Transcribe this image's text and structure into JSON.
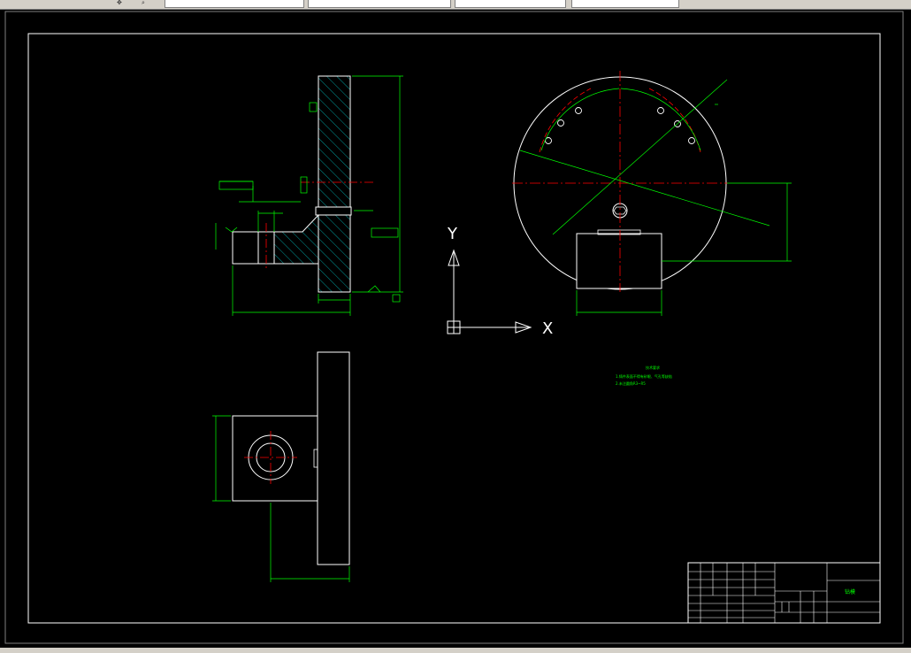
{
  "app": {
    "toolbar_icons": [
      "pan-icon",
      "zoom-icon"
    ]
  },
  "colors": {
    "background": "#000000",
    "outline": "#ffffff",
    "dimension": "#00ff00",
    "centerline": "#ff0000",
    "hatch": "#00ffff"
  },
  "ucs": {
    "y_label": "Y",
    "x_label": "X"
  },
  "notes": {
    "title": "技术要求",
    "line1": "1.铸件表面不得有砂眼、气孔等缺陷",
    "line2": "2.未注圆角R3~R5"
  },
  "title_block": {
    "part_name": "钻模"
  }
}
